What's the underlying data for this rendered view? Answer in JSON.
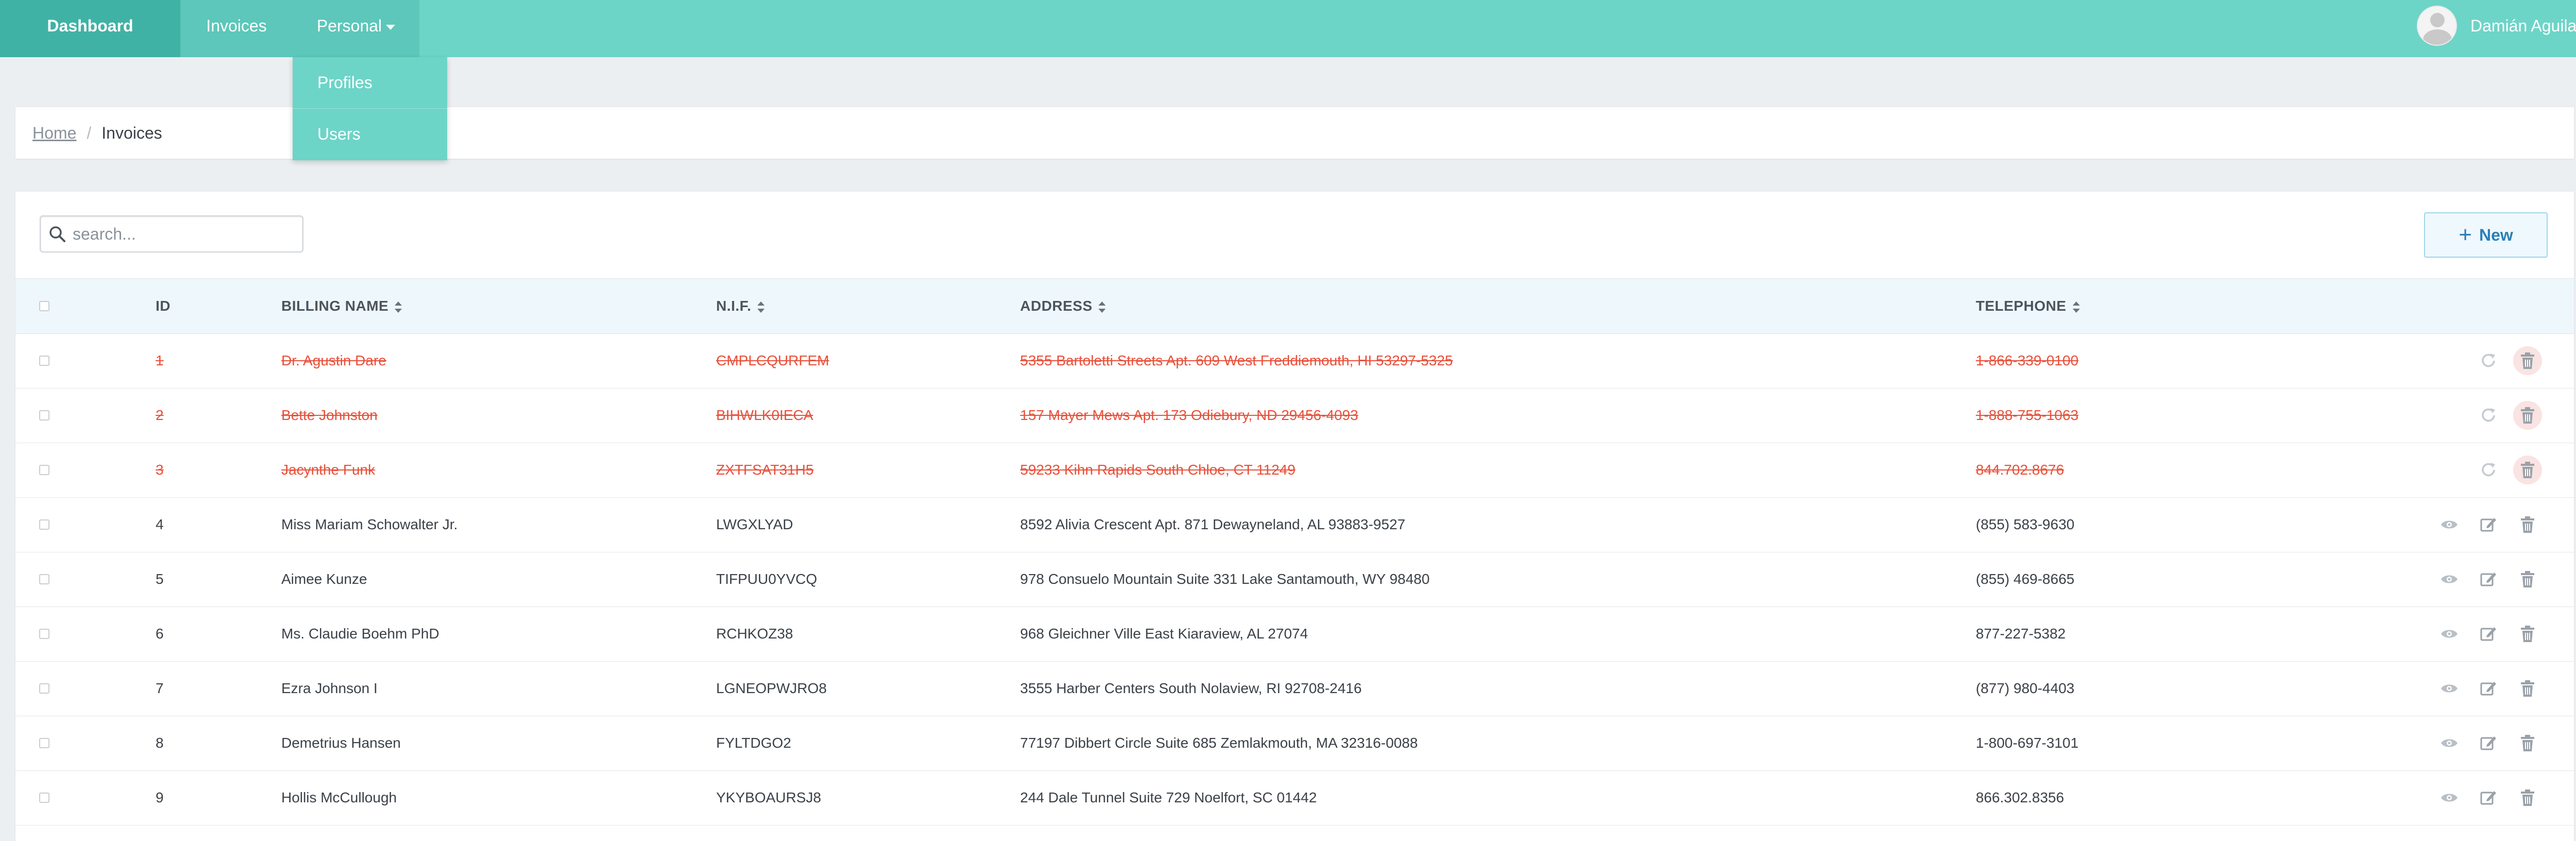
{
  "nav": {
    "dashboard": "Dashboard",
    "invoices": "Invoices",
    "personal": "Personal",
    "dropdown": [
      "Profiles",
      "Users"
    ],
    "user_name": "Damián Aguilar"
  },
  "breadcrumb": {
    "home": "Home",
    "separator": "/",
    "current": "Invoices"
  },
  "toolbar": {
    "search_placeholder": "search...",
    "new_label": "New"
  },
  "table": {
    "columns": {
      "id": "ID",
      "billing_name": "BILLING NAME",
      "nif": "N.I.F.",
      "address": "ADDRESS",
      "telephone": "TELEPHONE"
    },
    "rows": [
      {
        "id": "1",
        "name": "Dr. Agustin Dare",
        "nif": "CMPLCQURFEM",
        "address": "5355 Bartoletti Streets Apt. 609 West Freddiemouth, HI 53297-5325",
        "phone": "1-866-339-0100",
        "deleted": true
      },
      {
        "id": "2",
        "name": "Bette Johnston",
        "nif": "BIHWLK0IECA",
        "address": "157 Mayer Mews Apt. 173 Odiebury, ND 29456-4093",
        "phone": "1-888-755-1063",
        "deleted": true
      },
      {
        "id": "3",
        "name": "Jacynthe Funk",
        "nif": "ZXTFSAT31H5",
        "address": "59233 Kihn Rapids South Chloe, CT 11249",
        "phone": "844.702.8676",
        "deleted": true
      },
      {
        "id": "4",
        "name": "Miss Mariam Schowalter Jr.",
        "nif": "LWGXLYAD",
        "address": "8592 Alivia Crescent Apt. 871 Dewayneland, AL 93883-9527",
        "phone": "(855) 583-9630",
        "deleted": false
      },
      {
        "id": "5",
        "name": "Aimee Kunze",
        "nif": "TIFPUU0YVCQ",
        "address": "978 Consuelo Mountain Suite 331 Lake Santamouth, WY 98480",
        "phone": "(855) 469-8665",
        "deleted": false
      },
      {
        "id": "6",
        "name": "Ms. Claudie Boehm PhD",
        "nif": "RCHKOZ38",
        "address": "968 Gleichner Ville East Kiaraview, AL 27074",
        "phone": "877-227-5382",
        "deleted": false
      },
      {
        "id": "7",
        "name": "Ezra Johnson I",
        "nif": "LGNEOPWJRO8",
        "address": "3555 Harber Centers South Nolaview, RI 92708-2416",
        "phone": "(877) 980-4403",
        "deleted": false
      },
      {
        "id": "8",
        "name": "Demetrius Hansen",
        "nif": "FYLTDGO2",
        "address": "77197 Dibbert Circle Suite 685 Zemlakmouth, MA 32316-0088",
        "phone": "1-800-697-3101",
        "deleted": false
      },
      {
        "id": "9",
        "name": "Hollis McCullough",
        "nif": "YKYBOAURSJ8",
        "address": "244 Dale Tunnel Suite 729 Noelfort, SC 01442",
        "phone": "866.302.8356",
        "deleted": false
      }
    ]
  },
  "colors": {
    "nav": "#6dd4c8",
    "nav_active": "#40b2a5",
    "deleted_text": "#e8503a",
    "accent_blue": "#2a7fb8"
  },
  "icons": {
    "search": "search-icon",
    "restore": "restore-icon",
    "view": "eye-icon",
    "edit": "edit-icon",
    "delete": "trash-icon"
  }
}
